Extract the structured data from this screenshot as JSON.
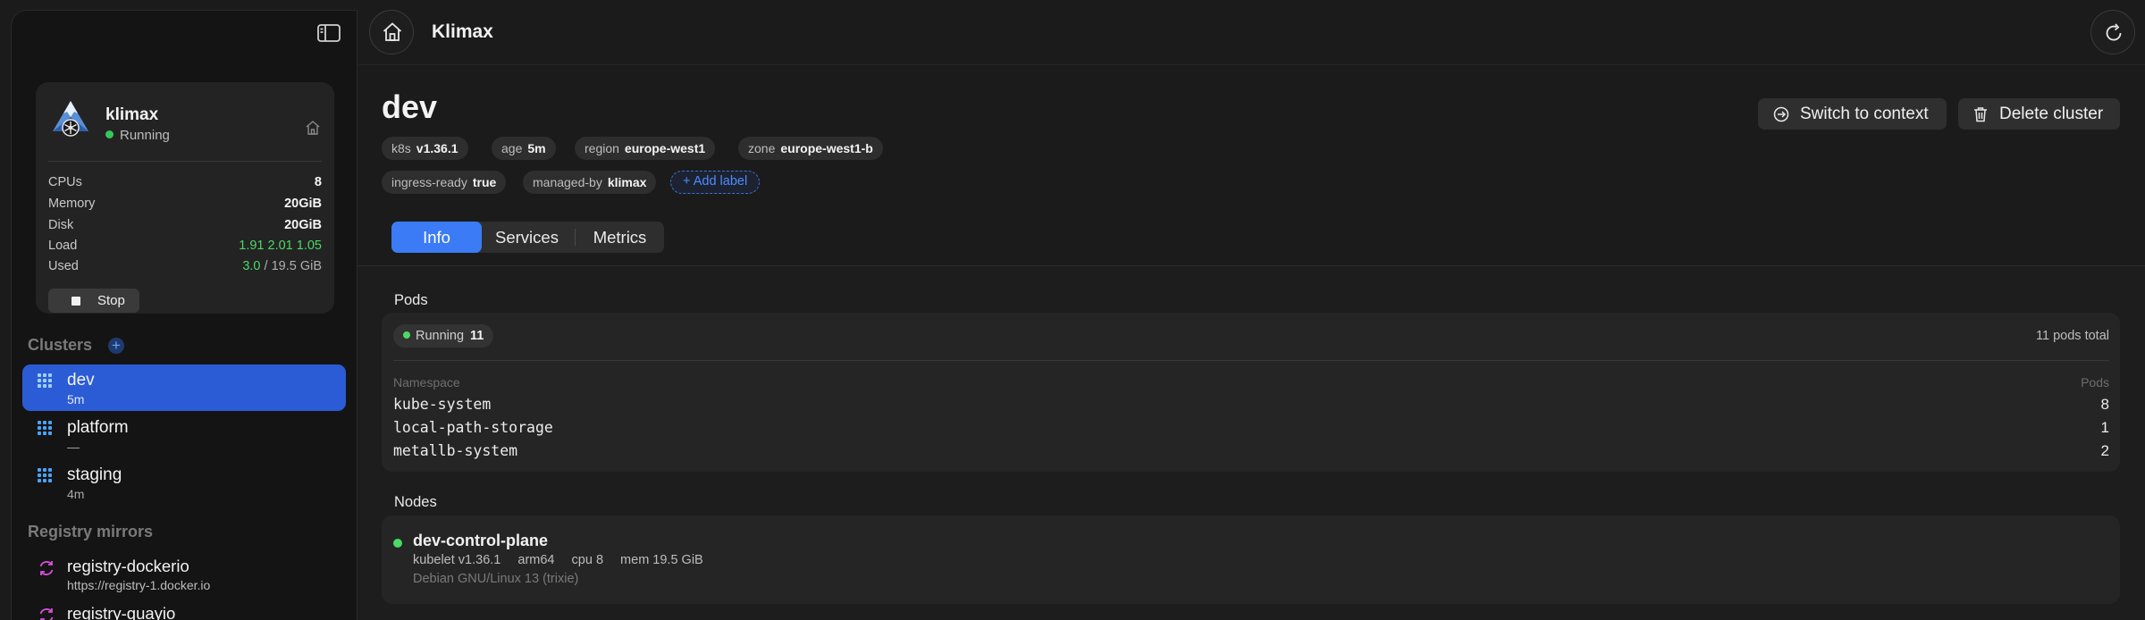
{
  "app": {
    "title": "Klimax"
  },
  "machine": {
    "name": "klimax",
    "status": "Running",
    "specs": [
      {
        "label": "CPUs",
        "value": "8"
      },
      {
        "label": "Memory",
        "value": "20GiB"
      },
      {
        "label": "Disk",
        "value": "20GiB"
      },
      {
        "label": "Load",
        "value": "1.91 2.01 1.05"
      }
    ],
    "used": {
      "label": "Used",
      "value": "3.0",
      "total": "/ 19.5 GiB"
    },
    "stop_label": "Stop"
  },
  "sidebar": {
    "clusters_header": "Clusters",
    "add_cluster": "+",
    "clusters": [
      {
        "name": "dev",
        "age": "5m",
        "active": true
      },
      {
        "name": "platform",
        "age": "—",
        "active": false
      },
      {
        "name": "staging",
        "age": "4m",
        "active": false
      }
    ],
    "registry_header": "Registry mirrors",
    "mirrors": [
      {
        "name": "registry-dockerio",
        "url": "https://registry-1.docker.io"
      },
      {
        "name": "registry-quayio",
        "url": ""
      }
    ]
  },
  "cluster": {
    "name": "dev",
    "chips": [
      {
        "key": "k8s",
        "value": "v1.36.1"
      },
      {
        "key": "age",
        "value": "5m"
      },
      {
        "key": "region",
        "value": "europe-west1"
      },
      {
        "key": "zone",
        "value": "europe-west1-b"
      },
      {
        "key": "ingress-ready",
        "value": "true"
      },
      {
        "key": "managed-by",
        "value": "klimax"
      }
    ],
    "add_label": "Add label",
    "switch_label": "Switch to context",
    "delete_label": "Delete cluster"
  },
  "tabs": [
    {
      "label": "Info",
      "active": true
    },
    {
      "label": "Services",
      "active": false
    },
    {
      "label": "Metrics",
      "active": false
    }
  ],
  "pods": {
    "title": "Pods",
    "running_label": "Running",
    "running_count": "11",
    "total": "11 pods total",
    "col_namespace": "Namespace",
    "col_pods": "Pods",
    "rows": [
      {
        "namespace": "kube-system",
        "count": "8"
      },
      {
        "namespace": "local-path-storage",
        "count": "1"
      },
      {
        "namespace": "metallb-system",
        "count": "2"
      }
    ]
  },
  "nodes": {
    "title": "Nodes",
    "items": [
      {
        "name": "dev-control-plane",
        "kubelet": "kubelet v1.36.1",
        "arch": "arm64",
        "cpu": "cpu 8",
        "mem": "mem 19.5 GiB",
        "os": "Debian GNU/Linux 13 (trixie)"
      }
    ]
  },
  "colors": {
    "accent": "#3b7bf5",
    "active_cluster": "#2b5cd6",
    "status_green": "#4cd964",
    "mirror_icon": "#d94fd9",
    "cluster_icon": "#4aa3ff"
  },
  "icons": {
    "sidebar_toggle": "sidebar-toggle-icon",
    "home": "home-icon",
    "refresh": "refresh-icon",
    "switch": "arrow-circle-icon",
    "delete": "trash-icon",
    "cluster": "grid-icon",
    "mirror": "sync-icon"
  }
}
